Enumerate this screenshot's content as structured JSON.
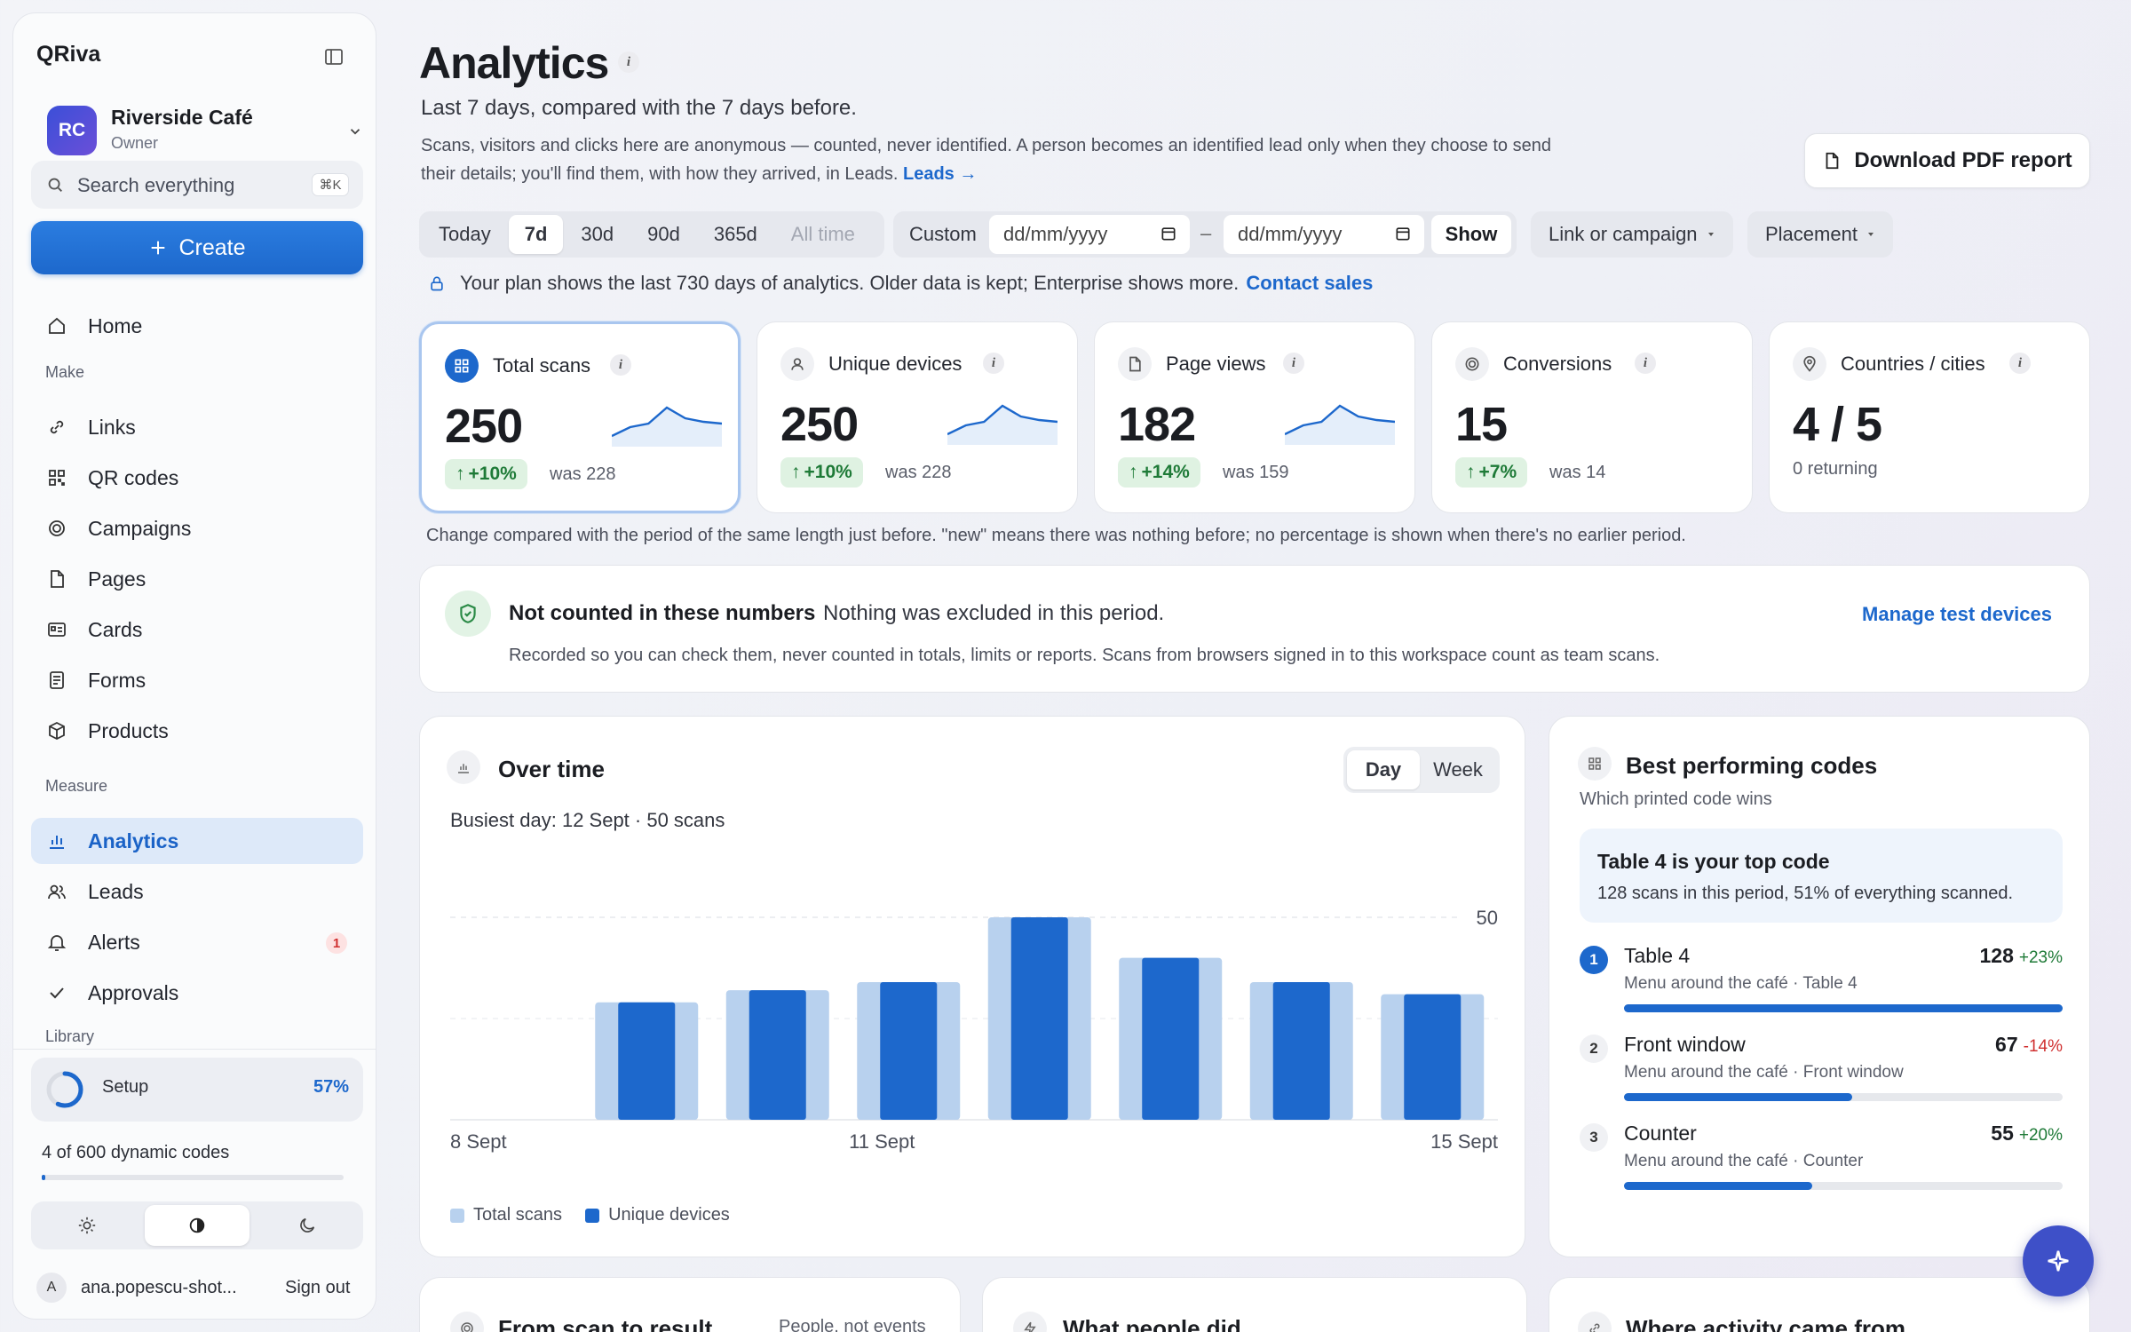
{
  "sidebar": {
    "brand": "QRiva",
    "workspace": {
      "initials": "RC",
      "name": "Riverside Café",
      "role": "Owner"
    },
    "search": {
      "placeholder": "Search everything",
      "shortcut": "⌘K"
    },
    "create_label": "Create",
    "home": "Home",
    "sections": {
      "make": "Make",
      "measure": "Measure",
      "library": "Library"
    },
    "make_items": [
      {
        "label": "Links",
        "icon": "link-icon"
      },
      {
        "label": "QR codes",
        "icon": "qr-icon"
      },
      {
        "label": "Campaigns",
        "icon": "target-icon"
      },
      {
        "label": "Pages",
        "icon": "page-icon"
      },
      {
        "label": "Cards",
        "icon": "card-icon"
      },
      {
        "label": "Forms",
        "icon": "form-icon"
      },
      {
        "label": "Products",
        "icon": "box-icon"
      }
    ],
    "measure_items": [
      {
        "label": "Analytics",
        "icon": "bar-chart-icon",
        "active": true
      },
      {
        "label": "Leads",
        "icon": "users-icon"
      },
      {
        "label": "Alerts",
        "icon": "bell-icon",
        "badge": "1"
      },
      {
        "label": "Approvals",
        "icon": "check-icon"
      }
    ],
    "setup": {
      "label": "Setup",
      "percent": "57%",
      "progress": 0.57
    },
    "codes": {
      "label": "4 of 600 dynamic codes",
      "used": 4,
      "total": 600
    },
    "theme": {
      "options": [
        "light",
        "auto",
        "dark"
      ],
      "selected": "auto"
    },
    "user": {
      "initial": "A",
      "email": "ana.popescu-shot...",
      "signout": "Sign out"
    }
  },
  "header": {
    "title": "Analytics",
    "subtitle": "Last 7 days, compared with the 7 days before.",
    "description": "Scans, visitors and clicks here are anonymous — counted, never identified. A person becomes an identified lead only when they choose to send their details; you'll find them, with how they arrived, in Leads.",
    "leads_link": "Leads →",
    "download_label": "Download PDF report"
  },
  "filters": {
    "ranges": [
      "Today",
      "7d",
      "30d",
      "90d",
      "365d",
      "All time"
    ],
    "selected_range": "7d",
    "disabled_range": "All time",
    "custom_label": "Custom",
    "date_from_placeholder": "dd/mm/yyyy",
    "date_to_placeholder": "dd/mm/yyyy",
    "dash": "–",
    "show_label": "Show",
    "link_filter": "Link or campaign",
    "placement_filter": "Placement"
  },
  "plan_notice": {
    "text": "Your plan shows the last 730 days of analytics. Older data is kept; Enterprise shows more.",
    "link": "Contact sales"
  },
  "kpis": [
    {
      "label": "Total scans",
      "value": "250",
      "change": "+10%",
      "was": "was 228",
      "icon": "qr-icon",
      "spark": [
        4,
        9,
        11,
        20,
        14,
        12,
        11
      ]
    },
    {
      "label": "Unique devices",
      "value": "250",
      "change": "+10%",
      "was": "was 228",
      "icon": "user-icon",
      "spark": [
        4,
        9,
        11,
        20,
        14,
        12,
        11
      ]
    },
    {
      "label": "Page views",
      "value": "182",
      "change": "+14%",
      "was": "was 159",
      "icon": "page-icon",
      "spark": [
        4,
        9,
        11,
        20,
        14,
        12,
        11
      ]
    },
    {
      "label": "Conversions",
      "value": "15",
      "change": "+7%",
      "was": "was 14",
      "icon": "target-icon"
    },
    {
      "label": "Countries / cities",
      "value": "4 / 5",
      "was": "0 returning",
      "icon": "pin-icon"
    }
  ],
  "kpi_note": "Change compared with the period of the same length just before. \"new\" means there was nothing before; no percentage is shown when there's no earlier period.",
  "excluded": {
    "title": "Not counted in these numbers",
    "status": "Nothing was excluded in this period.",
    "detail": "Recorded so you can check them, never counted in totals, limits or reports. Scans from browsers signed in to this workspace count as team scans.",
    "manage_link": "Manage test devices"
  },
  "over_time": {
    "title": "Over time",
    "granularity": [
      "Day",
      "Week"
    ],
    "selected_granularity": "Day",
    "busiest": "Busiest day: 12 Sept · 50 scans",
    "legend": [
      "Total scans",
      "Unique devices"
    ]
  },
  "chart_data": {
    "type": "bar",
    "categories": [
      "8 Sept",
      "9 Sept",
      "10 Sept",
      "11 Sept",
      "12 Sept",
      "13 Sept",
      "14 Sept",
      "15 Sept"
    ],
    "x_tick_labels": [
      "8 Sept",
      "11 Sept",
      "15 Sept"
    ],
    "series": [
      {
        "name": "Total scans",
        "color": "#b8d1ee",
        "values": [
          0,
          29,
          32,
          34,
          50,
          40,
          34,
          31
        ]
      },
      {
        "name": "Unique devices",
        "color": "#1d68cc",
        "values": [
          0,
          29,
          32,
          34,
          50,
          40,
          34,
          31
        ]
      }
    ],
    "ylim": [
      0,
      50
    ],
    "y_ticks": [
      "50"
    ],
    "grid": true,
    "legend_position": "bottom-left"
  },
  "best_codes": {
    "title": "Best performing codes",
    "subtitle": "Which printed code wins",
    "highlight_title": "Table 4 is your top code",
    "highlight_detail": "128 scans in this period, 51% of everything scanned.",
    "rows": [
      {
        "rank": "1",
        "name": "Table 4",
        "sub": "Menu around the café · Table 4",
        "value": "128",
        "change": "+23%",
        "dir": "up",
        "share": 1.0
      },
      {
        "rank": "2",
        "name": "Front window",
        "sub": "Menu around the café · Front window",
        "value": "67",
        "change": "-14%",
        "dir": "down",
        "share": 0.52
      },
      {
        "rank": "3",
        "name": "Counter",
        "sub": "Menu around the café · Counter",
        "value": "55",
        "change": "+20%",
        "dir": "up",
        "share": 0.43
      }
    ]
  },
  "bottom_cards": [
    {
      "title": "From scan to result",
      "note": "People, not events"
    },
    {
      "title": "What people did"
    },
    {
      "title": "Where activity came from"
    }
  ]
}
